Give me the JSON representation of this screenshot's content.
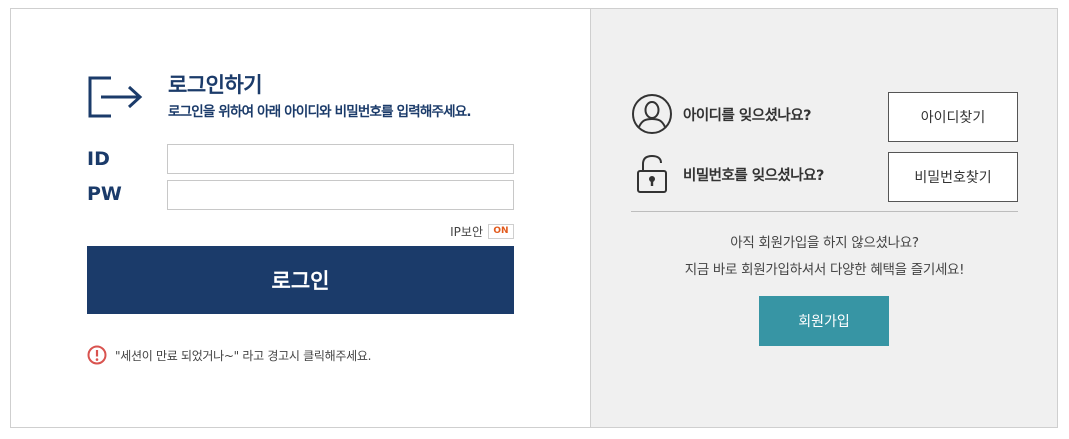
{
  "login": {
    "title": "로그인하기",
    "subtitle": "로그인을 위하여 아래 아이디와 비밀번호를 입력해주세요.",
    "id_label": "ID",
    "id_value": "",
    "pw_label": "PW",
    "pw_value": "",
    "ip_security_label": "IP보안",
    "ip_security_state": "ON",
    "login_button": "로그인",
    "notice": "\"세션이 만료 되었거나~\" 라고 경고시 클릭해주세요."
  },
  "find": {
    "id_question": "아이디를 잊으셨나요?",
    "id_button": "아이디찾기",
    "pw_question": "비밀번호를 잊으셨나요?",
    "pw_button": "비밀번호찾기"
  },
  "join": {
    "line1": "아직 회원가입을 하지 않으셨나요?",
    "line2": "지금 바로 회원가입하셔서 다양한 혜택을 즐기세요!",
    "button": "회원가입"
  },
  "colors": {
    "primary": "#1b3b6a",
    "teal": "#3795a4",
    "on_badge": "#e25a1c",
    "warning": "#d9534f"
  },
  "icons": {
    "login": "login-arrow-icon",
    "user": "user-circle-icon",
    "lock": "unlock-icon",
    "warning": "exclamation-circle-icon"
  }
}
